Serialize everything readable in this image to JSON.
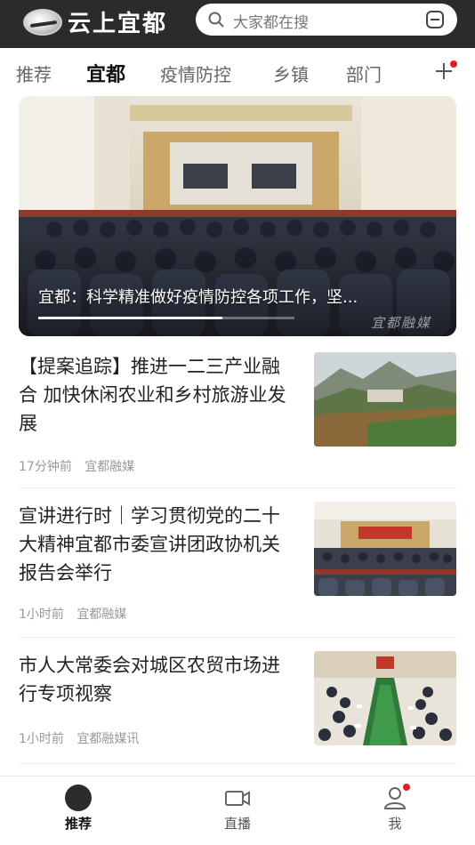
{
  "header": {
    "app_name": "云上宜都",
    "search_placeholder": "大家都在搜"
  },
  "tabs": [
    {
      "label": "推荐",
      "active": false
    },
    {
      "label": "宜都",
      "active": true
    },
    {
      "label": "疫情防控",
      "active": false
    },
    {
      "label": "乡镇",
      "active": false
    },
    {
      "label": "部门",
      "active": false
    }
  ],
  "hero": {
    "caption": "宜都：科学精准做好疫情防控各项工作，坚...",
    "watermark": "宜都融媒",
    "progress": 0.72
  },
  "news": [
    {
      "title": "【提案追踪】推进一二三产业融合 加快休闲农业和乡村旅游业发展",
      "time": "17分钟前",
      "source": "宜都融媒"
    },
    {
      "title": "宣讲进行时｜学习贯彻党的二十大精神宜都市委宣讲团政协机关报告会举行",
      "time": "1小时前",
      "source": "宜都融媒"
    },
    {
      "title": "市人大常委会对城区农贸市场进行专项视察",
      "time": "1小时前",
      "source": "宜都融媒讯"
    }
  ],
  "bottom_nav": [
    {
      "label": "推荐",
      "icon": "home-circle-icon",
      "active": true
    },
    {
      "label": "直播",
      "icon": "video-camera-icon",
      "active": false
    },
    {
      "label": "我",
      "icon": "user-icon",
      "active": false
    }
  ],
  "colors": {
    "header_bg": "#2b2b2b",
    "accent_dot": "#e02020",
    "text_primary": "#222222",
    "text_meta": "#999999"
  }
}
